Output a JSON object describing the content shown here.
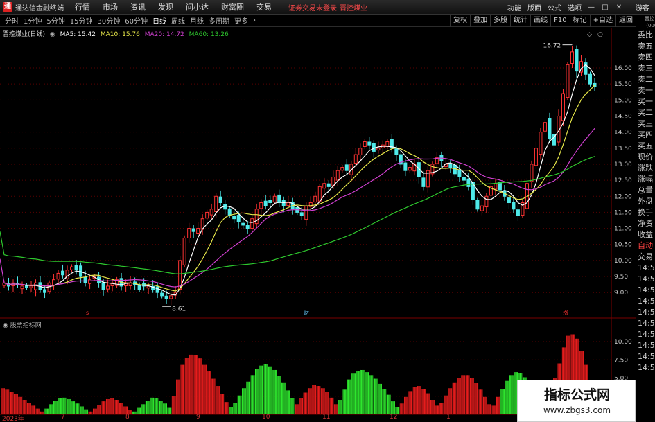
{
  "app": {
    "title": "通达信金融终端",
    "logo_char": "通"
  },
  "menu": [
    "行情",
    "市场",
    "资讯",
    "发现",
    "问小达",
    "财富圈",
    "交易"
  ],
  "notice": "证券交易未登录",
  "stock_name_red": "晋控煤业",
  "menu_right": [
    "功能",
    "版面",
    "公式",
    "选项"
  ],
  "guest": "游客",
  "window_buttons": [
    "—",
    "□",
    "✕"
  ],
  "periods": [
    "分时",
    "1分钟",
    "5分钟",
    "15分钟",
    "30分钟",
    "60分钟",
    "日线",
    "周线",
    "月线",
    "多周期",
    "更多"
  ],
  "active_period": "日线",
  "toolbar_right": [
    "复权",
    "叠加",
    "多股",
    "统计",
    "画线",
    "F10",
    "标记",
    "+自选",
    "返回"
  ],
  "chart_title": {
    "stock": "晋控煤业(日线)",
    "ma5": "MA5: 15.42",
    "ma10": "MA10: 15.76",
    "ma20": "MA20: 14.72",
    "ma60": "MA60: 13.26"
  },
  "colors": {
    "up": "#ff3333",
    "down": "#4ee9e9",
    "ma5": "#ffffff",
    "ma10": "#e8e84a",
    "ma20": "#d040d0",
    "ma60": "#2ec82e",
    "grid": "#5a0000",
    "axis_text": "#c8c8c8",
    "ind_up": "#ff2020",
    "ind_down": "#33ff33"
  },
  "annotations": {
    "high": "16.72",
    "low": "8.61",
    "marker_left": "s",
    "marker_mid": "财",
    "marker_right": "涨"
  },
  "indicator_title": "股票指标网",
  "right_panel": {
    "header": "晋控  (000",
    "items": [
      "委比",
      "卖五",
      "卖四",
      "卖三",
      "卖二",
      "卖一",
      "买一",
      "买二",
      "买三",
      "买四",
      "买五",
      "现价",
      "涨跌",
      "涨幅",
      "总量",
      "外盘",
      "换手",
      "净资",
      "收益",
      "自动",
      "交易",
      "14:5",
      "14:5",
      "14:5",
      "14:5",
      "14:5",
      "14:5",
      "14:5",
      "14:5",
      "14:5",
      "14:5"
    ]
  },
  "x_labels": [
    "2023年",
    "7",
    "8",
    "9",
    "10",
    "11",
    "12",
    "1"
  ],
  "watermark": {
    "title": "指标公式网",
    "url": "www.zbgs3.com"
  },
  "chart_data": [
    {
      "type": "candlestick",
      "title": "晋控煤业(日线)",
      "y_axis_ticks": [
        9.0,
        9.5,
        10.0,
        10.5,
        11.0,
        11.5,
        12.0,
        12.5,
        13.0,
        13.5,
        14.0,
        14.5,
        15.0,
        15.5,
        16.0
      ],
      "ylim": [
        8.4,
        16.95
      ],
      "series": [
        {
          "name": "MA5",
          "last": 15.42
        },
        {
          "name": "MA10",
          "last": 15.76
        },
        {
          "name": "MA20",
          "last": 14.72
        },
        {
          "name": "MA60",
          "last": 13.26
        }
      ],
      "annotated_high": 16.72,
      "annotated_low": 8.61,
      "close_approx": [
        9.3,
        9.2,
        9.3,
        9.25,
        9.2,
        9.15,
        9.2,
        9.3,
        9.1,
        9.0,
        9.3,
        9.4,
        9.6,
        9.55,
        9.7,
        9.8,
        9.7,
        9.5,
        9.3,
        9.4,
        9.5,
        9.3,
        9.1,
        9.2,
        9.3,
        9.4,
        9.2,
        9.3,
        9.3,
        9.25,
        9.1,
        9.2,
        9.2,
        9.1,
        9.0,
        8.9,
        8.8,
        8.9,
        9.0,
        10.0,
        10.7,
        11.0,
        10.9,
        11.0,
        11.3,
        11.5,
        11.6,
        12.0,
        11.8,
        11.6,
        11.4,
        11.3,
        11.2,
        11.1,
        11.0,
        11.3,
        11.6,
        11.8,
        11.7,
        11.8,
        12.0,
        11.8,
        11.7,
        11.8,
        11.6,
        11.5,
        11.4,
        11.7,
        11.8,
        12.0,
        12.3,
        12.4,
        12.3,
        12.6,
        12.8,
        12.9,
        12.8,
        13.0,
        13.3,
        13.5,
        13.7,
        13.6,
        13.4,
        13.5,
        13.6,
        13.7,
        13.5,
        13.3,
        13.0,
        12.8,
        12.9,
        13.0,
        12.6,
        12.3,
        12.8,
        13.0,
        13.2,
        13.1,
        13.0,
        12.9,
        12.7,
        12.6,
        12.5,
        12.3,
        11.9,
        11.6,
        11.7,
        12.0,
        12.3,
        12.4,
        12.2,
        12.0,
        11.8,
        11.6,
        11.4,
        11.8,
        12.4,
        13.0,
        13.5,
        14.0,
        14.3,
        13.8,
        13.6,
        14.5,
        15.2,
        16.1,
        16.5,
        15.9,
        16.2,
        15.8,
        15.5,
        15.42
      ]
    },
    {
      "type": "bar",
      "title": "股票指标网",
      "y_axis_ticks": [
        2.5,
        5.0,
        7.5,
        10.0
      ],
      "ylim": [
        0,
        12
      ],
      "values": [
        3.6,
        3.4,
        3.1,
        2.8,
        2.4,
        2.0,
        1.6,
        1.2,
        0.8,
        0.4,
        0.8,
        1.4,
        1.9,
        2.2,
        2.3,
        2.1,
        1.8,
        1.5,
        1.1,
        0.7,
        0.4,
        0.8,
        1.3,
        1.8,
        2.1,
        2.2,
        2.0,
        1.6,
        1.1,
        0.6,
        0.4,
        0.9,
        1.4,
        1.9,
        2.3,
        2.2,
        1.9,
        1.5,
        0.9,
        2.5,
        4.8,
        6.8,
        7.8,
        8.2,
        8.1,
        7.7,
        6.8,
        5.9,
        4.9,
        3.9,
        2.8,
        1.7,
        1.0,
        1.6,
        2.6,
        3.6,
        4.5,
        5.4,
        6.2,
        6.7,
        6.9,
        6.6,
        6.1,
        5.3,
        4.4,
        3.3,
        2.2,
        1.4,
        2.2,
        3.0,
        3.6,
        4.0,
        3.9,
        3.6,
        3.1,
        2.3,
        1.4,
        2.0,
        3.4,
        4.8,
        5.6,
        6.0,
        6.1,
        5.8,
        5.4,
        4.9,
        4.2,
        3.5,
        2.7,
        1.8,
        1.0,
        1.5,
        2.4,
        3.2,
        3.8,
        3.9,
        3.5,
        2.9,
        2.0,
        1.2,
        1.6,
        2.6,
        3.6,
        4.4,
        5.0,
        5.4,
        5.4,
        5.0,
        4.3,
        3.4,
        2.4,
        1.4,
        1.2,
        2.4,
        3.5,
        4.6,
        5.4,
        5.8,
        5.7,
        5.1,
        4.2,
        3.1,
        1.9,
        1.0,
        2.0,
        3.4,
        5.0,
        7.0,
        9.2,
        10.8,
        11.0,
        10.4,
        8.7,
        6.8,
        4.2,
        2.3
      ],
      "colors_sign": [
        1,
        1,
        1,
        1,
        1,
        1,
        1,
        1,
        1,
        1,
        -1,
        -1,
        -1,
        -1,
        -1,
        -1,
        -1,
        -1,
        -1,
        -1,
        1,
        1,
        1,
        1,
        1,
        1,
        1,
        1,
        1,
        1,
        -1,
        -1,
        -1,
        -1,
        -1,
        -1,
        -1,
        -1,
        -1,
        1,
        1,
        1,
        1,
        1,
        1,
        1,
        1,
        1,
        1,
        1,
        1,
        1,
        -1,
        -1,
        -1,
        -1,
        -1,
        -1,
        -1,
        -1,
        -1,
        -1,
        -1,
        -1,
        -1,
        -1,
        -1,
        1,
        1,
        1,
        1,
        1,
        1,
        1,
        1,
        1,
        1,
        -1,
        -1,
        -1,
        -1,
        -1,
        -1,
        -1,
        -1,
        -1,
        -1,
        -1,
        -1,
        -1,
        -1,
        1,
        1,
        1,
        1,
        1,
        1,
        1,
        1,
        1,
        1,
        1,
        1,
        1,
        1,
        1,
        1,
        1,
        1,
        1,
        1,
        1,
        1,
        1,
        -1,
        -1,
        -1,
        -1,
        -1,
        -1,
        -1,
        -1,
        -1,
        -1,
        -1,
        1,
        1,
        1,
        1,
        1,
        1,
        1,
        1,
        1,
        1,
        1,
        1,
        1
      ]
    }
  ]
}
